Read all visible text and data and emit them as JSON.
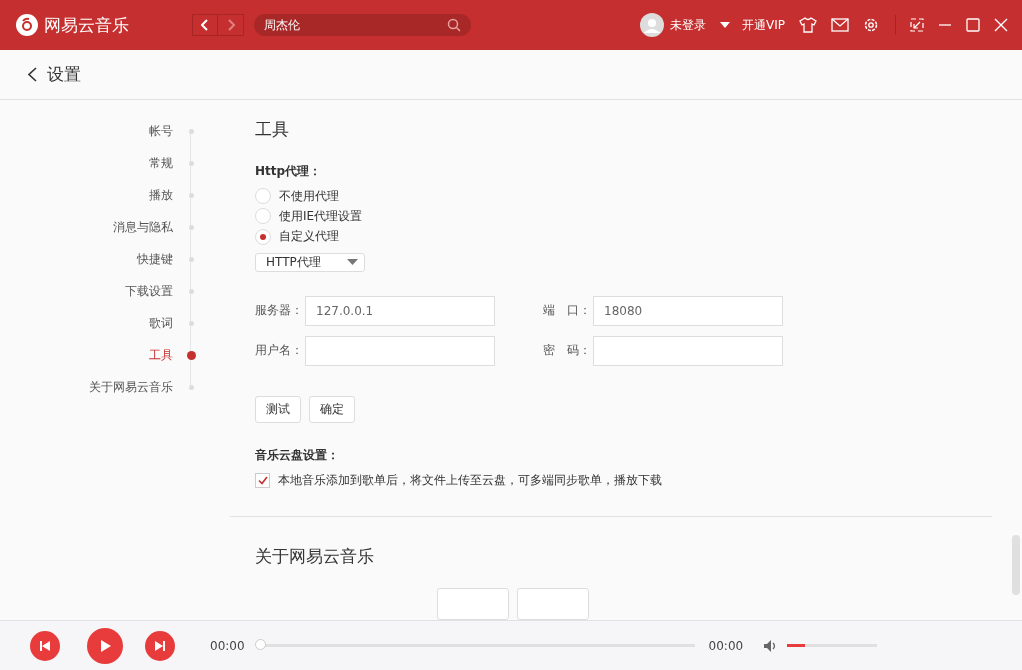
{
  "app": {
    "title": "网易云音乐"
  },
  "search": {
    "value": "周杰伦"
  },
  "user": {
    "name": "未登录",
    "vip": "开通VIP"
  },
  "page": {
    "title": "设置"
  },
  "sidebar": {
    "items": [
      {
        "label": "帐号",
        "selected": false
      },
      {
        "label": "常规",
        "selected": false
      },
      {
        "label": "播放",
        "selected": false
      },
      {
        "label": "消息与隐私",
        "selected": false
      },
      {
        "label": "快捷键",
        "selected": false
      },
      {
        "label": "下载设置",
        "selected": false
      },
      {
        "label": "歌词",
        "selected": false
      },
      {
        "label": "工具",
        "selected": true
      },
      {
        "label": "关于网易云音乐",
        "selected": false
      }
    ]
  },
  "tools": {
    "title": "工具",
    "proxy_label": "Http代理：",
    "proxy_options": [
      {
        "label": "不使用代理",
        "selected": false
      },
      {
        "label": "使用IE代理设置",
        "selected": false
      },
      {
        "label": "自定义代理",
        "selected": true
      }
    ],
    "proxy_type": "HTTP代理",
    "fields": [
      {
        "label": "服务器：",
        "value": "127.0.0.1"
      },
      {
        "label": "端　口：",
        "value": "18080"
      },
      {
        "label": "用户名："
      },
      {
        "label": "密　码："
      }
    ],
    "buttons": [
      "测试",
      "确定"
    ],
    "cloud_label": "音乐云盘设置：",
    "cloud_option": {
      "label": "本地音乐添加到歌单后，将文件上传至云盘，可多端同步歌单，播放下载",
      "checked": true
    }
  },
  "about": {
    "title": "关于网易云音乐"
  },
  "player": {
    "elapsed": "00:00",
    "duration": "00:00",
    "progress": {
      "level": 0
    },
    "volume": {
      "level": 0.2
    }
  }
}
